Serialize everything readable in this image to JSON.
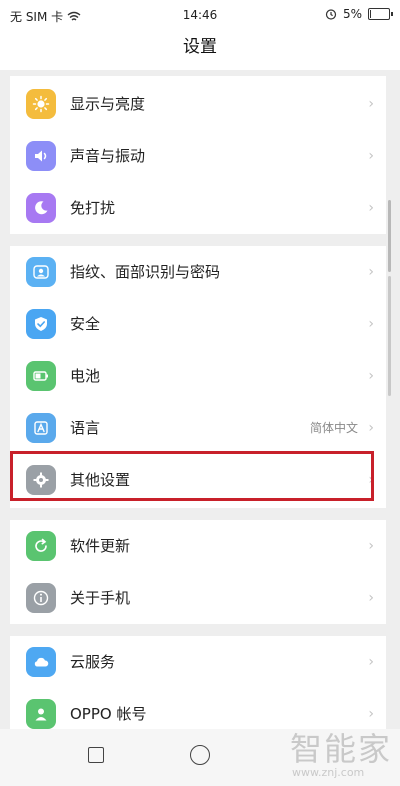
{
  "status_bar": {
    "carrier": "无 SIM 卡",
    "time": "14:46",
    "battery_percent": "5%",
    "battery_level": 0.05
  },
  "header": {
    "title": "设置"
  },
  "sections": [
    {
      "items": [
        {
          "label": "显示与亮度",
          "icon": "brightness-icon",
          "color": "#f4bc3d"
        },
        {
          "label": "声音与振动",
          "icon": "speaker-icon",
          "color": "#8d8ef7"
        },
        {
          "label": "免打扰",
          "icon": "moon-icon",
          "color": "#a779f2"
        }
      ]
    },
    {
      "items": [
        {
          "label": "指纹、面部识别与密码",
          "icon": "fingerprint-icon",
          "color": "#5bb1f3"
        },
        {
          "label": "安全",
          "icon": "shield-icon",
          "color": "#4aa6f2"
        },
        {
          "label": "电池",
          "icon": "battery-icon",
          "color": "#5ac470"
        },
        {
          "label": "语言",
          "icon": "language-icon",
          "color": "#5aa9ec",
          "value": "简体中文"
        },
        {
          "label": "其他设置",
          "icon": "gear-icon",
          "color": "#9aa0a6"
        }
      ]
    },
    {
      "items": [
        {
          "label": "软件更新",
          "icon": "update-icon",
          "color": "#5ac470"
        },
        {
          "label": "关于手机",
          "icon": "info-icon",
          "color": "#9aa0a6"
        }
      ]
    },
    {
      "items": [
        {
          "label": "云服务",
          "icon": "cloud-icon",
          "color": "#4ea8f2"
        },
        {
          "label": "OPPO 帐号",
          "icon": "person-icon",
          "color": "#5ac470"
        }
      ]
    }
  ],
  "chevron": "›",
  "watermark": {
    "brand": "智能家",
    "url": "www.znj.com"
  },
  "highlight_color": "#c8202a"
}
